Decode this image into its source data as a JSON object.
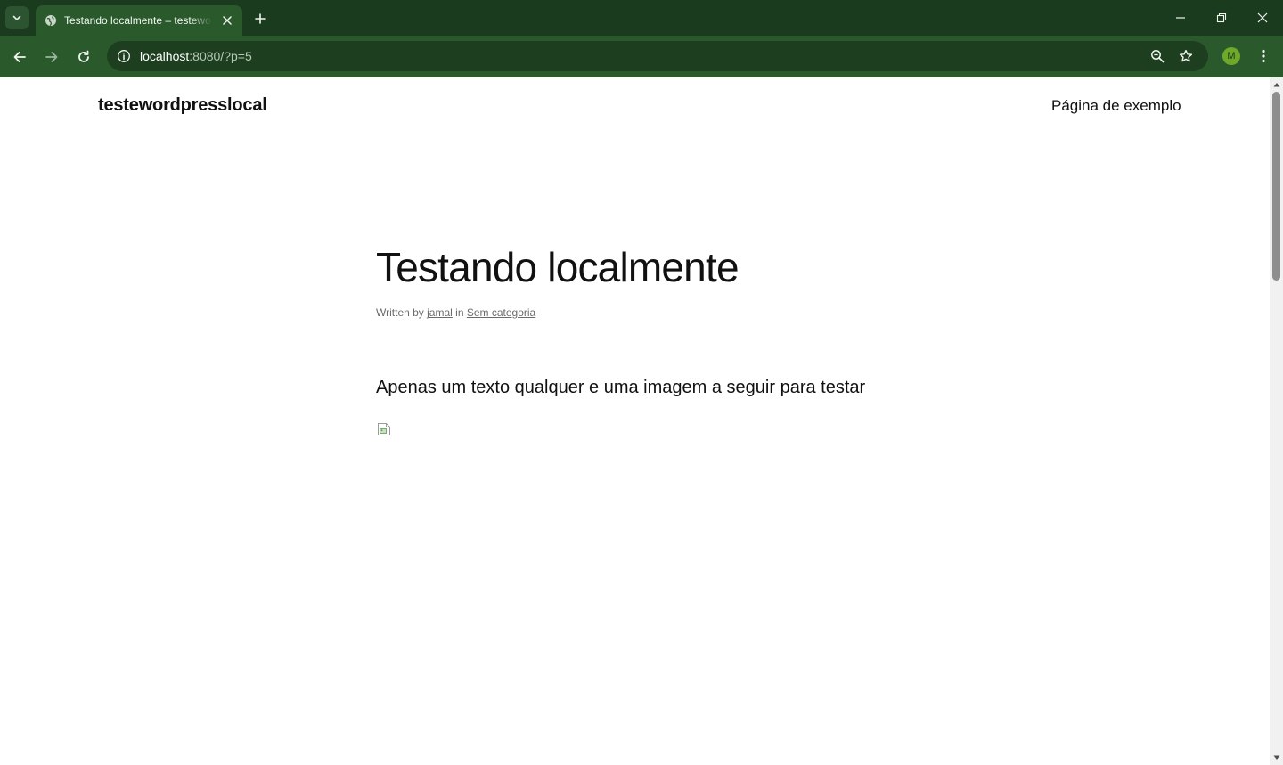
{
  "browser": {
    "tab": {
      "title": "Testando localmente – testewordpresslocal"
    },
    "address_bar": {
      "host": "localhost",
      "path": ":8080/?p=5"
    },
    "profile_initial": "M",
    "icons": {
      "tab_search": "chevron-down-icon",
      "favicon": "globe-icon",
      "tab_close": "close-icon",
      "new_tab": "plus-icon",
      "minimize": "minimize-icon",
      "restore": "restore-icon",
      "close_window": "close-icon",
      "back": "back-arrow-icon",
      "forward": "forward-arrow-icon",
      "reload": "reload-icon",
      "site_info": "info-icon",
      "zoom": "zoom-icon",
      "bookmark": "star-icon",
      "menu": "kebab-menu-icon"
    },
    "colors": {
      "tabbar": "#1b3b1e",
      "toolbar": "#2a5a2c",
      "omnibox": "#1d3f1f",
      "avatar": "#6fa82a"
    }
  },
  "site": {
    "title": "testewordpresslocal",
    "nav": {
      "sample_page": "Página de exemplo"
    }
  },
  "post": {
    "title": "Testando localmente",
    "meta": {
      "written_by": "Written by",
      "author": "jamal",
      "in": "in",
      "category": "Sem categoria"
    },
    "body": "Apenas um texto qualquer e uma imagem a seguir para testar"
  }
}
